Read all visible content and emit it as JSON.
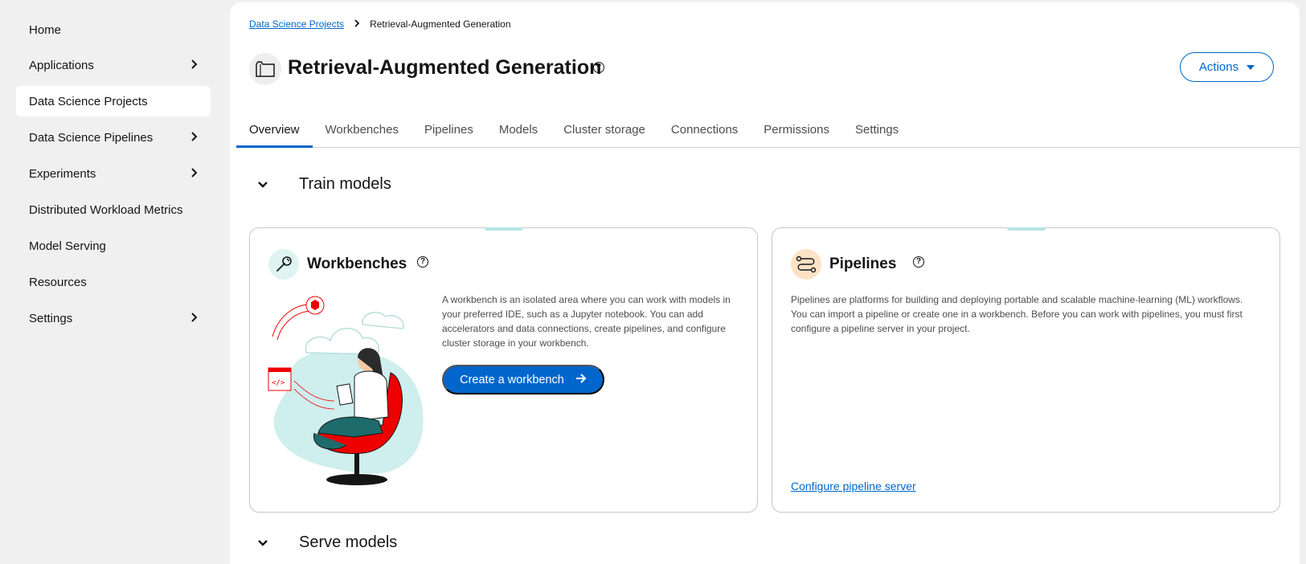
{
  "sidebar": {
    "items": [
      {
        "label": "Home",
        "expandable": false
      },
      {
        "label": "Applications",
        "expandable": true
      },
      {
        "label": "Data Science Projects",
        "expandable": false,
        "active": true
      },
      {
        "label": "Data Science Pipelines",
        "expandable": true
      },
      {
        "label": "Experiments",
        "expandable": true
      },
      {
        "label": "Distributed Workload Metrics",
        "expandable": false
      },
      {
        "label": "Model Serving",
        "expandable": false
      },
      {
        "label": "Resources",
        "expandable": false
      },
      {
        "label": "Settings",
        "expandable": true
      }
    ]
  },
  "breadcrumb": {
    "parent": "Data Science Projects",
    "current": "Retrieval-Augmented Generation"
  },
  "header": {
    "title": "Retrieval-Augmented Generation",
    "actions_label": "Actions"
  },
  "tabs": [
    {
      "label": "Overview",
      "active": true
    },
    {
      "label": "Workbenches"
    },
    {
      "label": "Pipelines"
    },
    {
      "label": "Models"
    },
    {
      "label": "Cluster storage"
    },
    {
      "label": "Connections"
    },
    {
      "label": "Permissions"
    },
    {
      "label": "Settings"
    }
  ],
  "sections": {
    "train": {
      "label": "Train models"
    },
    "serve": {
      "label": "Serve models"
    }
  },
  "workbenches_card": {
    "title": "Workbenches",
    "description": "A workbench is an isolated area where you can work with models in your preferred IDE, such as a Jupyter notebook. You can add accelerators and data connections, create pipelines, and configure cluster storage in your workbench.",
    "button_label": "Create a workbench"
  },
  "pipelines_card": {
    "title": "Pipelines",
    "description": "Pipelines are platforms for building and deploying portable and scalable machine-learning (ML) workflows. You can import a pipeline or create one in a workbench. Before you can work with pipelines, you must first configure a pipeline server in your project.",
    "link_label": "Configure pipeline server"
  },
  "colors": {
    "accent": "#0066cc",
    "workbench_icon_bg": "#dff3f3",
    "pipeline_icon_bg": "#fde2c6",
    "card_tab": "#b9e5e5"
  },
  "icons": {
    "project": "folder-icon",
    "workbench": "wrench-icon",
    "pipeline": "pipeline-icon",
    "help": "help-icon"
  }
}
